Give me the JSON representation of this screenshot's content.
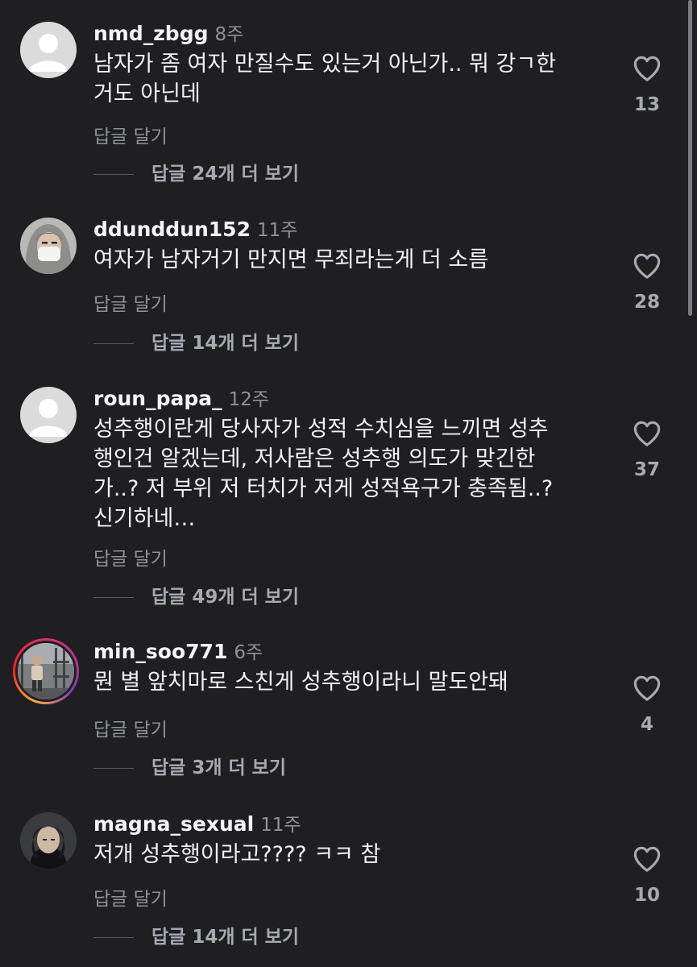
{
  "comments": [
    {
      "username": "nmd_zbgg",
      "time": "8주",
      "lines": [
        "남자가 좀 여자 만질수도 있는거 아닌가.. 뭐 강ㄱ한",
        "거도 아닌데"
      ],
      "reply_label": "답글 달기",
      "view_replies": "답글 24개 더 보기",
      "likes": "13",
      "avatar": "default-avatar"
    },
    {
      "username": "ddunddun152",
      "time": "11주",
      "lines": [
        "여자가 남자거기 만지면 무죄라는게 더 소름"
      ],
      "reply_label": "답글 달기",
      "view_replies": "답글 14개 더 보기",
      "likes": "28",
      "avatar": "photo-avatar-hoodie"
    },
    {
      "username": "roun_papa_",
      "time": "12주",
      "lines": [
        "성추행이란게 당사자가 성적 수치심을 느끼면 성추",
        "행인건 알겠는데, 저사람은 성추행 의도가 맞긴한",
        "가..? 저 부위 저 터치가 저게 성적욕구가 충족됨..?",
        "신기하네…"
      ],
      "reply_label": "답글 달기",
      "view_replies": "답글 49개 더 보기",
      "likes": "37",
      "avatar": "default-avatar"
    },
    {
      "username": "min_soo771",
      "time": "6주",
      "lines": [
        "뭔 별 앞치마로 스친게 성추행이라니 말도안돼"
      ],
      "reply_label": "답글 달기",
      "view_replies": "답글 3개 더 보기",
      "likes": "4",
      "avatar": "photo-avatar-gym-story-ring"
    },
    {
      "username": "magna_sexual",
      "time": "11주",
      "lines": [
        "저개 성추행이라고???? ㅋㅋ 참"
      ],
      "reply_label": "답글 달기",
      "view_replies": "답글 14개 더 보기",
      "likes": "10",
      "avatar": "photo-avatar-portrait"
    }
  ],
  "icons": {
    "like": "heart-outline-icon"
  },
  "colors": {
    "background": "#1f1f22",
    "text_primary": "#f1f2f4",
    "text_secondary": "#8e9196",
    "story_ring": [
      "#fcb045",
      "#fd1d1d",
      "#e1306c",
      "#833ab4"
    ]
  }
}
